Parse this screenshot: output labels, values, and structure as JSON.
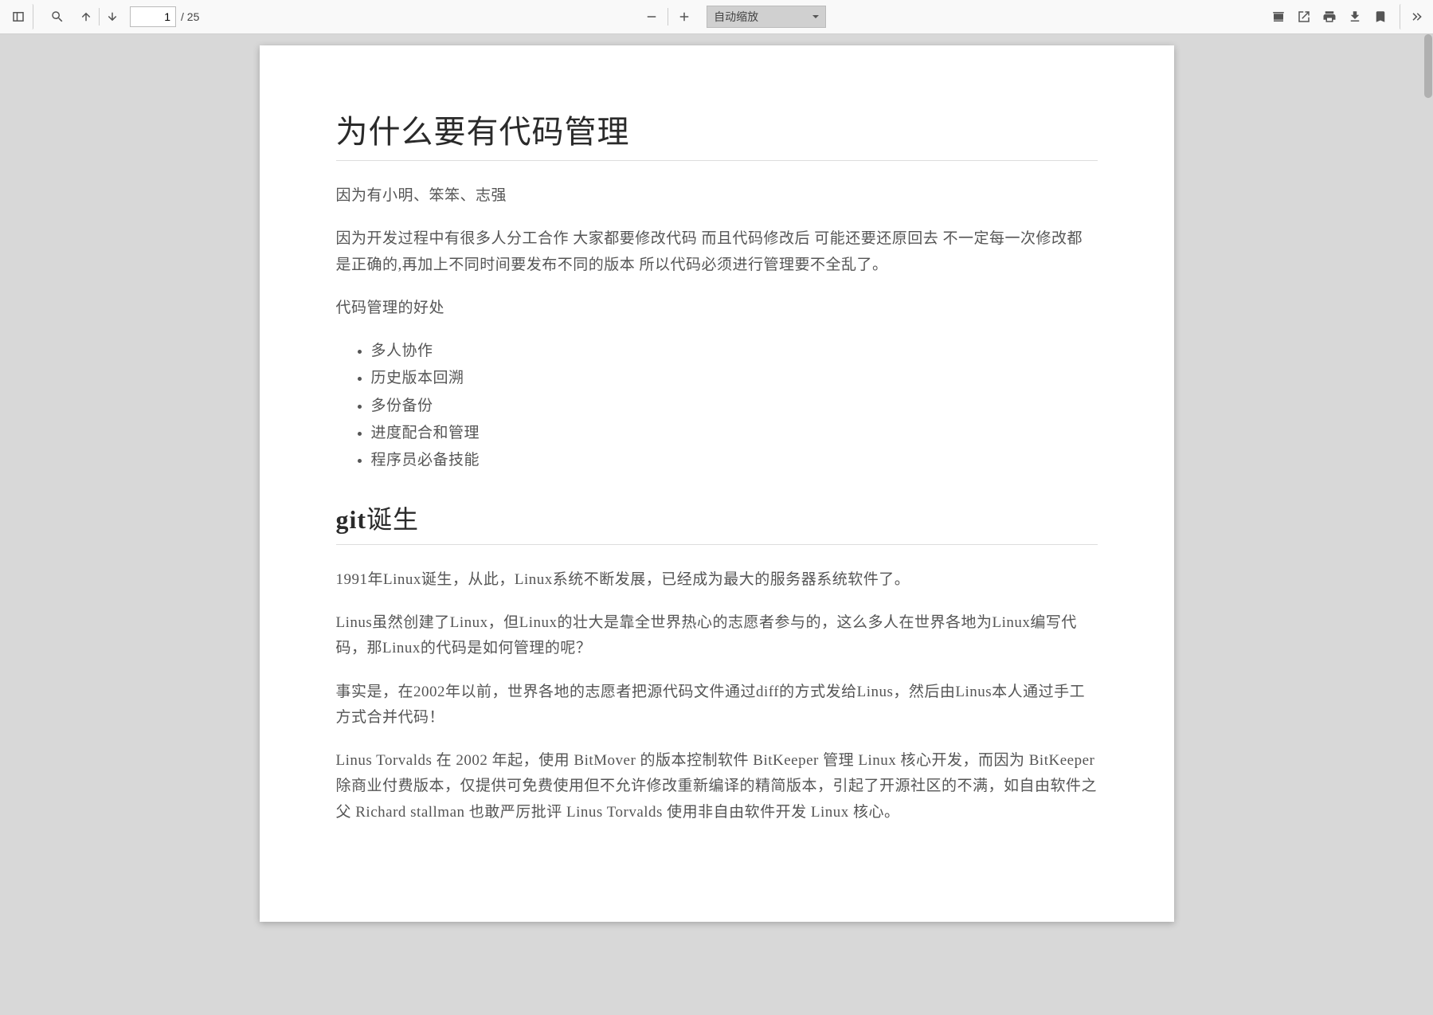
{
  "toolbar": {
    "page_input_value": "1",
    "page_total": "/ 25",
    "zoom_select": "自动缩放"
  },
  "doc": {
    "h1": "为什么要有代码管理",
    "p1": "因为有小明、笨笨、志强",
    "p2": "因为开发过程中有很多人分工合作 大家都要修改代码 而且代码修改后 可能还要还原回去 不一定每一次修改都是正确的,再加上不同时间要发布不同的版本 所以代码必须进行管理要不全乱了。",
    "p3": "代码管理的好处",
    "list": [
      "多人协作",
      "历史版本回溯",
      "多份备份",
      "进度配合和管理",
      "程序员必备技能"
    ],
    "h2_strong": "git",
    "h2_rest": "诞生",
    "p4": "1991年Linux诞生，从此，Linux系统不断发展，已经成为最大的服务器系统软件了。",
    "p5": "Linus虽然创建了Linux，但Linux的壮大是靠全世界热心的志愿者参与的，这么多人在世界各地为Linux编写代码，那Linux的代码是如何管理的呢？",
    "p6": "事实是，在2002年以前，世界各地的志愿者把源代码文件通过diff的方式发给Linus，然后由Linus本人通过手工方式合并代码！",
    "p7": "Linus Torvalds 在 2002 年起，使用 BitMover 的版本控制软件 BitKeeper 管理 Linux 核心开发，而因为 BitKeeper 除商业付费版本，仅提供可免费使用但不允许修改重新编译的精简版本，引起了开源社区的不满，如自由软件之父 Richard stallman 也敢严厉批评 Linus Torvalds 使用非自由软件开发 Linux 核心。"
  }
}
